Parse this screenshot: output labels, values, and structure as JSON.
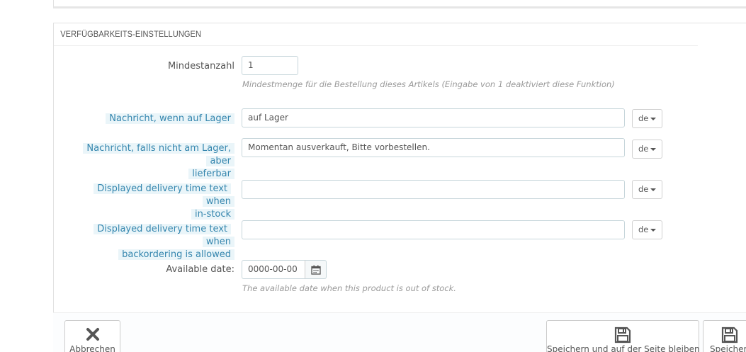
{
  "section": {
    "title": "VERFÜGBARKEITS-EINSTELLUNGEN"
  },
  "min_qty": {
    "label": "Mindestanzahl",
    "value": "1",
    "help": "Mindestmenge für die Bestellung dieses Artikels (Eingabe von 1 deaktiviert diese Funktion)"
  },
  "in_stock_msg": {
    "label": "Nachricht, wenn auf Lager",
    "value": "auf Lager",
    "lang": "de"
  },
  "backorder_msg": {
    "label_line1": "Nachricht, falls nicht am Lager, aber",
    "label_line2": "lieferbar",
    "value": "Momentan ausverkauft, Bitte vorbestellen.",
    "lang": "de"
  },
  "delivery_in_stock": {
    "label_line1": "Displayed delivery time text when",
    "label_line2": "in-stock",
    "value": "",
    "lang": "de"
  },
  "delivery_backorder": {
    "label_line1": "Displayed delivery time text when",
    "label_line2": "backordering is allowed",
    "value": "",
    "lang": "de"
  },
  "available_date": {
    "label": "Available date:",
    "value": "0000-00-00",
    "help": "The available date when this product is out of stock."
  },
  "footer": {
    "cancel_label": "Abbrechen",
    "save_stay_label": "Speichern und auf der Seite bleiben",
    "save_label": "Speichern"
  }
}
